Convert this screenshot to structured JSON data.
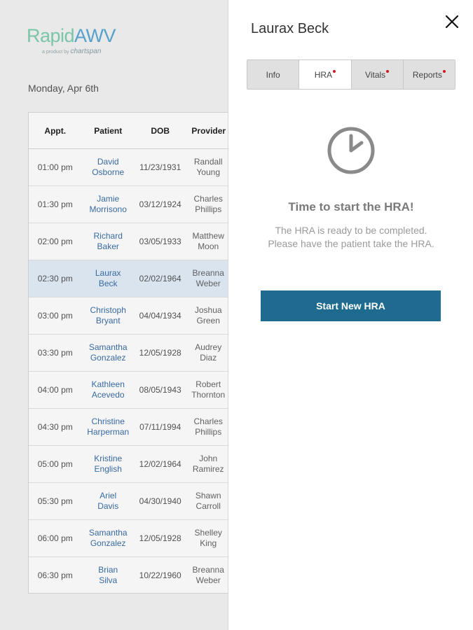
{
  "logo": {
    "main_a": "Rapid",
    "main_b": "AWV",
    "sub_prefix": "a product by",
    "sub_brand": "chartspan"
  },
  "date": "Monday, Apr 6th",
  "table": {
    "headers": {
      "appt": "Appt.",
      "patient": "Patient",
      "dob": "DOB",
      "provider": "Provider"
    },
    "rows": [
      {
        "time": "01:00 pm",
        "first": "David",
        "last": "Osborne",
        "dob": "11/23/1931",
        "pfirst": "Randall",
        "plast": "Young"
      },
      {
        "time": "01:30 pm",
        "first": "Jamie",
        "last": "Morrisono",
        "dob": "03/12/1924",
        "pfirst": "Charles",
        "plast": "Phillips"
      },
      {
        "time": "02:00 pm",
        "first": "Richard",
        "last": "Baker",
        "dob": "03/05/1933",
        "pfirst": "Matthew",
        "plast": "Moon"
      },
      {
        "time": "02:30 pm",
        "first": "Laurax",
        "last": "Beck",
        "dob": "02/02/1964",
        "pfirst": "Breanna",
        "plast": "Weber"
      },
      {
        "time": "03:00 pm",
        "first": "Christoph",
        "last": "Bryant",
        "dob": "04/04/1934",
        "pfirst": "Joshua",
        "plast": "Green"
      },
      {
        "time": "03:30 pm",
        "first": "Samantha",
        "last": "Gonzalez",
        "dob": "12/05/1928",
        "pfirst": "Audrey",
        "plast": "Diaz"
      },
      {
        "time": "04:00 pm",
        "first": "Kathleen",
        "last": "Acevedo",
        "dob": "08/05/1943",
        "pfirst": "Robert",
        "plast": "Thornton"
      },
      {
        "time": "04:30 pm",
        "first": "Christine",
        "last": "Harperman",
        "dob": "07/11/1994",
        "pfirst": "Charles",
        "plast": "Phillips"
      },
      {
        "time": "05:00 pm",
        "first": "Kristine",
        "last": "English",
        "dob": "12/02/1964",
        "pfirst": "John",
        "plast": "Ramirez"
      },
      {
        "time": "05:30 pm",
        "first": "Ariel",
        "last": "Davis",
        "dob": "04/30/1940",
        "pfirst": "Shawn",
        "plast": "Carroll"
      },
      {
        "time": "06:00 pm",
        "first": "Samantha",
        "last": "Gonzalez",
        "dob": "12/05/1928",
        "pfirst": "Shelley",
        "plast": "King"
      },
      {
        "time": "06:30 pm",
        "first": "Brian",
        "last": "Silva",
        "dob": "10/22/1960",
        "pfirst": "Breanna",
        "plast": "Weber"
      }
    ],
    "selected_index": 3
  },
  "panel": {
    "title": "Laurax Beck",
    "tabs": [
      {
        "label": "Info",
        "dot": false,
        "active": false
      },
      {
        "label": "HRA",
        "dot": true,
        "active": true
      },
      {
        "label": "Vitals",
        "dot": true,
        "active": false
      },
      {
        "label": "Reports",
        "dot": true,
        "active": false
      }
    ],
    "clock_icon": "clock-icon",
    "heading": "Time to start the HRA!",
    "description": "The HRA is ready to be completed. Please have the patient take the HRA.",
    "button_label": "Start New HRA"
  },
  "colors": {
    "accent": "#1f6b8f",
    "dot": "#d0161e",
    "selected_row": "#e3eef9",
    "link": "#3b6fa7"
  }
}
